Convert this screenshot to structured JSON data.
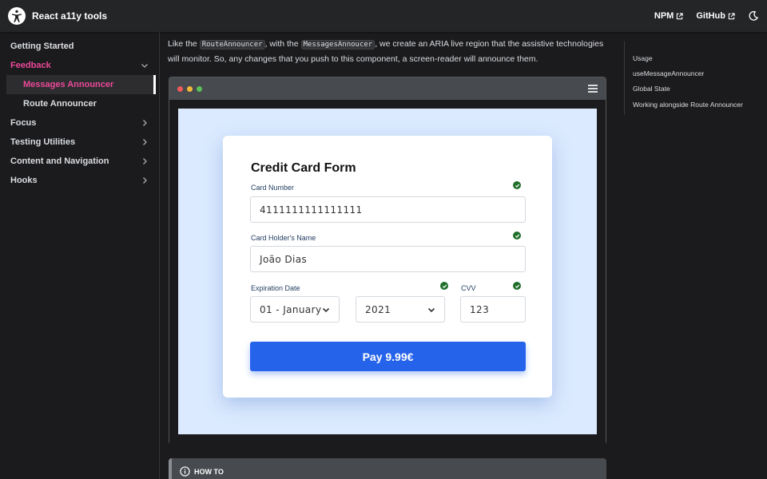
{
  "navbar": {
    "title": "React a11y tools",
    "links": [
      "NPM",
      "GitHub"
    ]
  },
  "sidebar": {
    "items": [
      {
        "label": "Getting Started"
      },
      {
        "label": "Feedback",
        "sub": [
          "Messages Announcer",
          "Route Announcer"
        ]
      },
      {
        "label": "Focus"
      },
      {
        "label": "Testing Utilities"
      },
      {
        "label": "Content and Navigation"
      },
      {
        "label": "Hooks"
      }
    ]
  },
  "intro": {
    "p1": "Like the ",
    "code1": "RouteAnnouncer",
    "p2": ", with the ",
    "code2": "MessagesAnnoucer",
    "p3": ", we create an ARIA live region that the assistive technologies will monitor. So, any changes that you push to this component, a screen-reader will announce them."
  },
  "form": {
    "title": "Credit Card Form",
    "card_number_label": "Card Number",
    "card_number_value": "4111111111111111",
    "holder_label": "Card Holder's Name",
    "holder_value": "João Dias",
    "expiration_label": "Expiration Date",
    "month_value": "01 - January",
    "year_value": "2021",
    "cvv_label": "CVV",
    "cvv_value": "123",
    "pay_label": "Pay 9.99€"
  },
  "admonition": {
    "title": "HOW TO"
  },
  "toc": [
    "Usage",
    "useMessageAnnouncer",
    "Global State",
    "Working alongside Route Announcer"
  ],
  "colors": {
    "accent": "#ec4899",
    "button": "#2563eb",
    "check": "#1f6f2a"
  }
}
